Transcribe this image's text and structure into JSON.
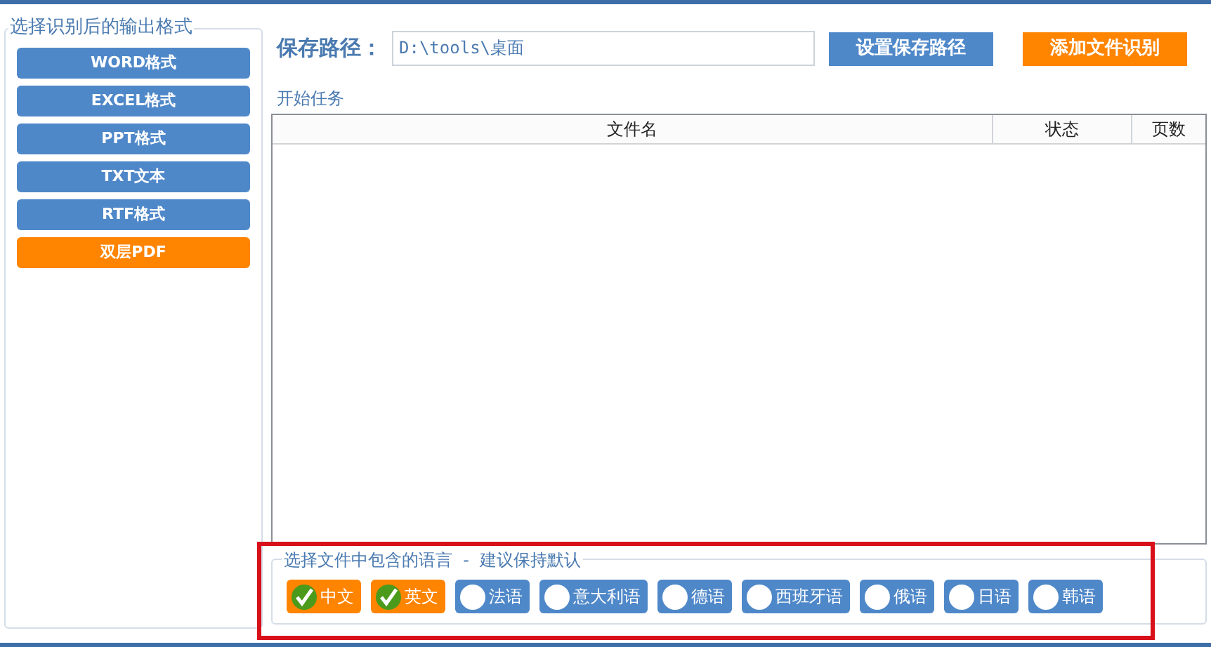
{
  "output_formats": {
    "legend": "选择识别后的输出格式",
    "items": [
      {
        "label": "WORD格式",
        "selected": false
      },
      {
        "label": "EXCEL格式",
        "selected": false
      },
      {
        "label": "PPT格式",
        "selected": false
      },
      {
        "label": "TXT文本",
        "selected": false
      },
      {
        "label": "RTF格式",
        "selected": false
      },
      {
        "label": "双层PDF",
        "selected": true
      }
    ]
  },
  "save_path": {
    "label": "保存路径：",
    "value": "D:\\tools\\桌面"
  },
  "buttons": [
    {
      "label": "设置保存路径",
      "kind": "primary"
    },
    {
      "label": "添加文件识别",
      "kind": "accent"
    }
  ],
  "start_task": "开始任务",
  "table": {
    "columns": [
      "文件名",
      "状态",
      "页数"
    ]
  },
  "languages": {
    "legend": "选择文件中包含的语言  -  建议保持默认",
    "items": [
      {
        "label": "中文",
        "checked": true
      },
      {
        "label": "英文",
        "checked": true
      },
      {
        "label": "法语",
        "checked": false
      },
      {
        "label": "意大利语",
        "checked": false
      },
      {
        "label": "德语",
        "checked": false
      },
      {
        "label": "西班牙语",
        "checked": false
      },
      {
        "label": "俄语",
        "checked": false
      },
      {
        "label": "日语",
        "checked": false
      },
      {
        "label": "韩语",
        "checked": false
      }
    ]
  },
  "highlight": {
    "on": true
  }
}
